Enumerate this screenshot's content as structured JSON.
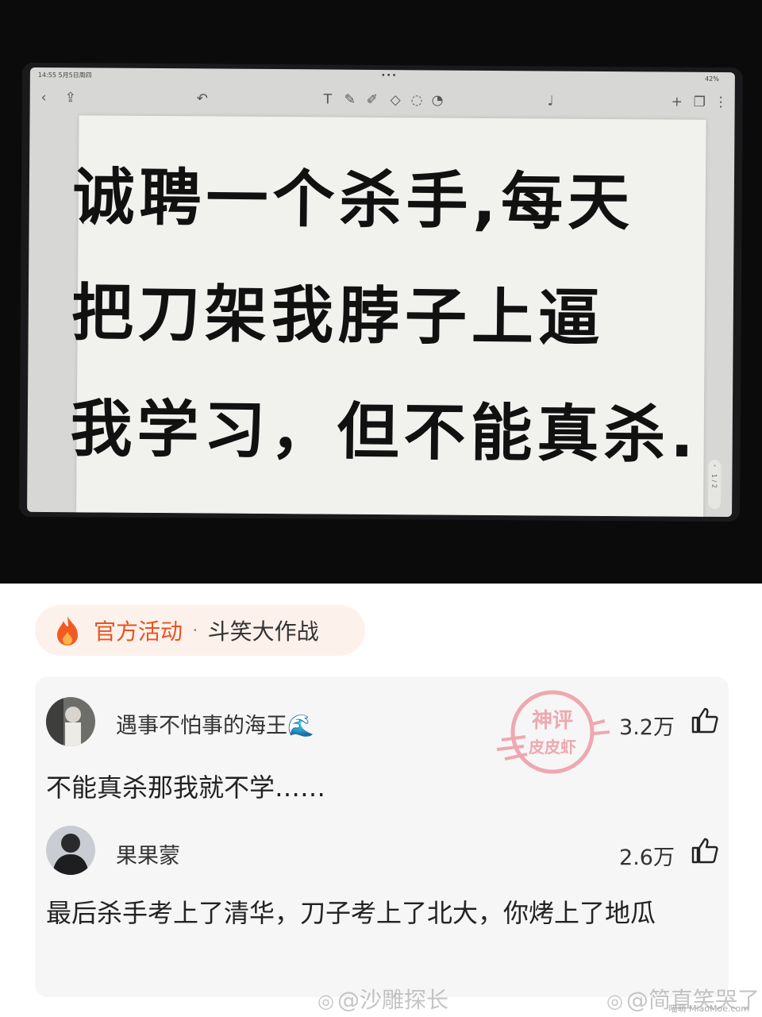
{
  "photo": {
    "status_time": "14:55  5月5日周四",
    "battery": "42%",
    "handwritten_lines": [
      "诚聘一个杀手,每天",
      "把刀架我脖子上逼",
      "我学习，但不能真杀."
    ],
    "page_indicator": "1 / 2"
  },
  "activity": {
    "label": "官方活动",
    "separator": "·",
    "name": "斗笑大作战",
    "icon": "flame-icon",
    "color": "#e8541f"
  },
  "comments": [
    {
      "username": "遇事不怕事的海王",
      "emoji": "🌊",
      "likes": "3.2万",
      "text": "不能真杀那我就不学……"
    },
    {
      "username": "果果蒙",
      "likes": "2.6万",
      "text": "最后杀手考上了清华，刀子考上了北大，你烤上了地瓜"
    }
  ],
  "stamp": {
    "top_text": "神评",
    "bottom_text": "皮皮虾"
  },
  "watermarks": {
    "left": "@沙雕探长",
    "right": "@简直笑哭了",
    "corner": "喵萌 MiaoMoe.com"
  }
}
